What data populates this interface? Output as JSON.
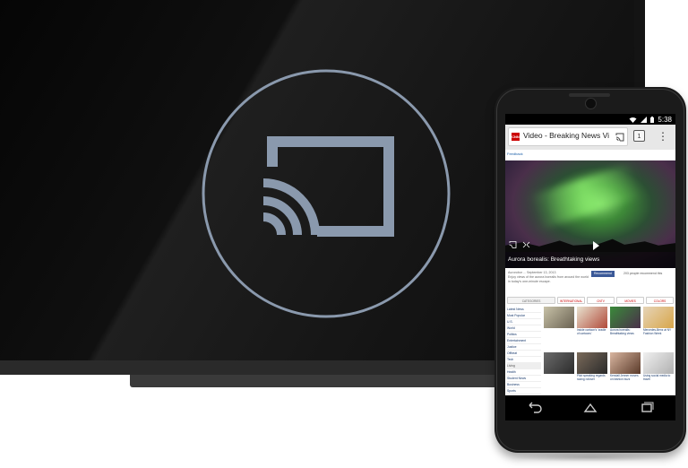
{
  "tv": {
    "cast_icon": "cast-icon"
  },
  "phone": {
    "status": {
      "wifi_icon": "wifi-icon",
      "signal_icon": "signal-icon",
      "battery_icon": "battery-icon",
      "time": "5:38"
    },
    "browser": {
      "site_logo_text": "CNN",
      "tab_title": "Video - Breaking News Vi...",
      "tab_count": "1",
      "menu_icon": "more-vert-icon"
    },
    "page": {
      "feedback_link": "Feedback",
      "video_caption": "Aurora borealis: Breathtaking views",
      "meta_line1": "Aurorobor ... September 13, 2013",
      "meta_line2": "Enjoy views of the aurora borealis from around the world",
      "meta_line3": "in today's one-minute escape.",
      "fb_button": "Recommend",
      "fb_text": "203 people recommend this",
      "tabs": [
        "CATEGORIES",
        "INTERNATIONAL",
        "CNTV",
        "MOVIES",
        "COLORS"
      ],
      "sidebar": [
        "Latest News",
        "Most Popular",
        "U.S.",
        "World",
        "Politics",
        "Entertainment",
        "Justice",
        "Offbeat",
        "Tech",
        "Living",
        "Health",
        "Student News",
        "Business",
        "Sports"
      ],
      "videos": [
        {
          "caption": ""
        },
        {
          "caption": "Inside cartoon's 'cradle of cartoons'"
        },
        {
          "caption": "Aurora borealis: Breathtaking views"
        },
        {
          "caption": "Mercedes-Benz at NY Fashion Week"
        },
        {
          "caption": ""
        },
        {
          "caption": "Pilot speaking regards racing rollover"
        },
        {
          "caption": "Kendall Jenner moves on fashion buzz"
        },
        {
          "caption": "Using social media to travel"
        }
      ]
    },
    "nav": {
      "back_icon": "back-icon",
      "home_icon": "home-icon",
      "recents_icon": "recents-icon"
    }
  },
  "colors": {
    "cast_stroke": "#8a99ad",
    "cnn_red": "#cc0000"
  }
}
